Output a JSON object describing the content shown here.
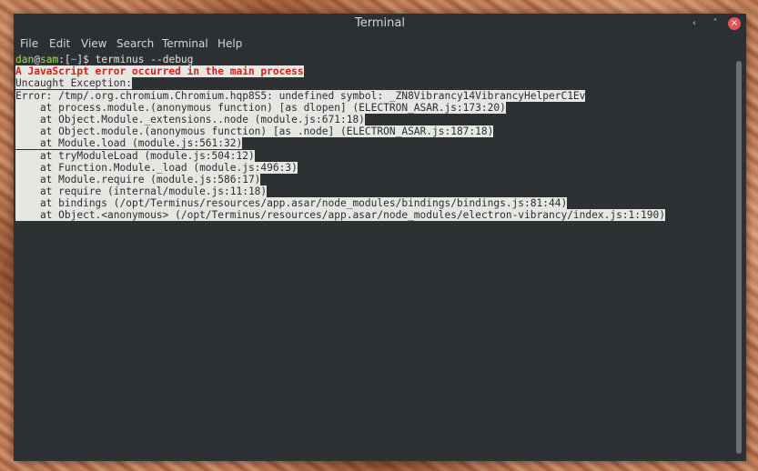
{
  "window": {
    "title": "Terminal"
  },
  "controls": {
    "minimize_icon": "minimize-icon",
    "maximize_icon": "maximize-icon",
    "close_icon": "close-icon",
    "minimize_glyph": "‹",
    "maximize_glyph": "˄",
    "close_glyph": "×",
    "close_color": "#e25555"
  },
  "menubar": {
    "items": [
      "File",
      "Edit",
      "View",
      "Search",
      "Terminal",
      "Help"
    ]
  },
  "terminal": {
    "prompt": {
      "user": "dan",
      "at": "@",
      "host": "sam",
      "open": ":[",
      "dir": "~",
      "close": "]$ ",
      "command": "terminus --debug"
    },
    "error_heading": "A JavaScript error occurred in the main process",
    "lines": [
      "Uncaught Exception:",
      "Error: /tmp/.org.chromium.Chromium.hqp8S5: undefined symbol: _ZN8Vibrancy14VibrancyHelperC1Ev",
      "    at process.module.(anonymous function) [as dlopen] (ELECTRON_ASAR.js:173:20)",
      "    at Object.Module._extensions..node (module.js:671:18)",
      "    at Object.module.(anonymous function) [as .node] (ELECTRON_ASAR.js:187:18)",
      "    at Module.load (module.js:561:32)",
      "    at tryModuleLoad (module.js:504:12)",
      "    at Function.Module._load (module.js:496:3)",
      "    at Module.require (module.js:586:17)",
      "    at require (internal/module.js:11:18)",
      "    at bindings (/opt/Terminus/resources/app.asar/node_modules/bindings/bindings.js:81:44)",
      "    at Object.<anonymous> (/opt/Terminus/resources/app.asar/node_modules/electron-vibrancy/index.js:1:190)"
    ],
    "colors": {
      "background": "#2e3134",
      "text": "#e0e0de",
      "selection": "#e6e6e2",
      "error": "#d0221e",
      "user": "#9bd95a",
      "directory": "#7db3e0"
    }
  }
}
